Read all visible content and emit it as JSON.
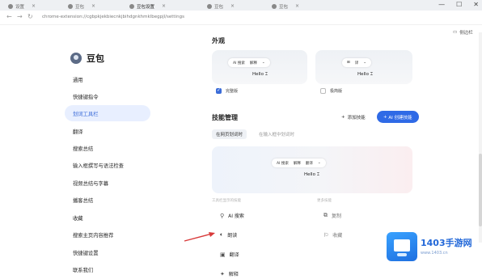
{
  "tabs": [
    {
      "label": "设置",
      "icon": "settings-icon",
      "close": "×"
    },
    {
      "label": "豆包",
      "icon": "doubao-icon",
      "close": "×"
    },
    {
      "label": "豆包设置",
      "icon": "doubao-icon",
      "close": "×"
    },
    {
      "label": "豆包",
      "icon": "doubao-icon",
      "close": "×"
    },
    {
      "label": "豆包",
      "icon": "doubao-icon",
      "close": "×"
    }
  ],
  "window_controls": {
    "minimize": "—",
    "maximize": "☐",
    "close": "✕"
  },
  "address": {
    "url": "chrome-extension://cgbpkjekbiecnkjbihdgnkhmklbegpjl/settings"
  },
  "corner_action": {
    "label": "侧边栏"
  },
  "sidebar": {
    "brand": "豆包",
    "items": [
      {
        "label": "通用"
      },
      {
        "label": "快捷键指令"
      },
      {
        "label": "划词工具栏"
      },
      {
        "label": "翻译"
      },
      {
        "label": "搜索总结"
      },
      {
        "label": "输入框撰写与语法检查"
      },
      {
        "label": "视频总结与字幕"
      },
      {
        "label": "播客总结"
      },
      {
        "label": "收藏"
      },
      {
        "label": "搜索主页内容推荐"
      },
      {
        "label": "快捷键设置"
      },
      {
        "label": "联系我们"
      }
    ],
    "active_index": 2
  },
  "appearance": {
    "title": "外观",
    "option1": {
      "toolbar": [
        "AI 搜索",
        "解释",
        "⌄"
      ],
      "hello": "Hello",
      "label": "完整版",
      "selected": true
    },
    "option2": {
      "toolbar": [
        "⊞",
        "译",
        "⌄"
      ],
      "hello": "Hello",
      "label": "极简版",
      "selected": false
    }
  },
  "skills": {
    "title": "技能管理",
    "add_label": "添加技能",
    "add_ai_label": "AI 创建技能",
    "subtabs": [
      "在网页划词时",
      "在输入框中划词时"
    ],
    "active_subtab": 0,
    "preview": {
      "toolbar": [
        "AI 搜索",
        "解释",
        "翻译",
        "⌄"
      ],
      "hello": "Hello"
    },
    "col_left_header": "工具栏显示的技能",
    "col_right_header": "更多技能",
    "left_items": [
      {
        "label": "AI 搜索",
        "icon": "search-icon"
      },
      {
        "label": "朗读",
        "icon": "speaker-icon"
      },
      {
        "label": "翻译",
        "icon": "translate-icon"
      },
      {
        "label": "解释",
        "icon": "explain-icon"
      }
    ],
    "right_items": [
      {
        "label": "复制",
        "icon": "copy-icon"
      },
      {
        "label": "收藏",
        "icon": "bookmark-icon"
      }
    ]
  },
  "watermark": {
    "title": "1403手游网",
    "sub": "www.1403.cn"
  },
  "colors": {
    "accent": "#2f6ae6",
    "active_bg": "#e8efff"
  }
}
